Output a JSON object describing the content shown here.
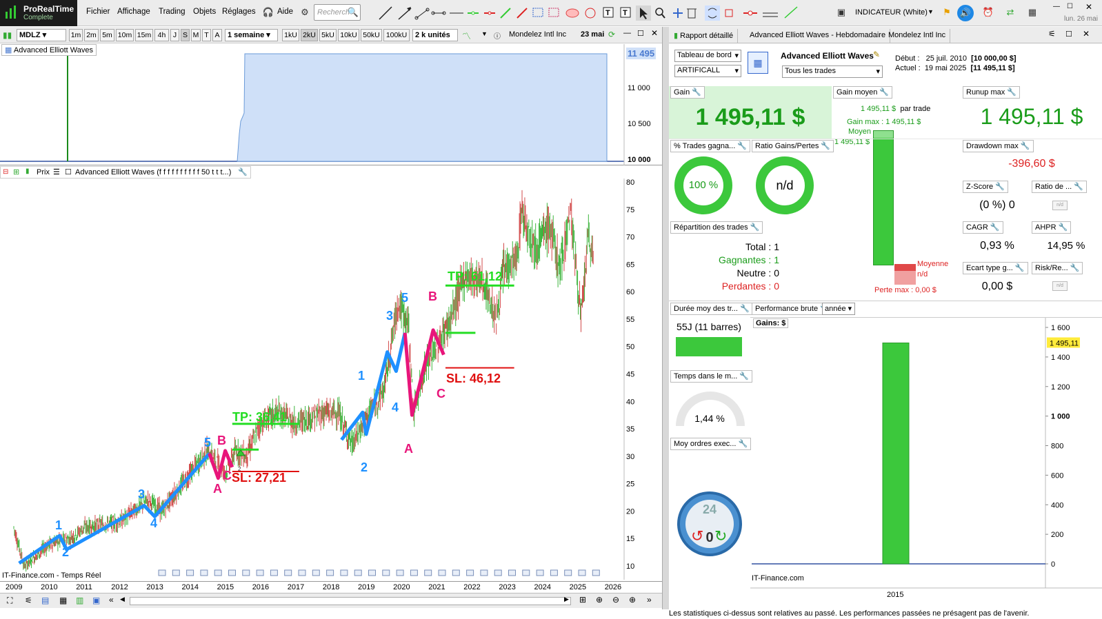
{
  "app": {
    "name": "ProRealTime",
    "edition": "Complete",
    "date": "lun. 26 mai"
  },
  "menu": [
    "Fichier",
    "Affichage",
    "Trading",
    "Objets",
    "Réglages",
    "Aide"
  ],
  "search": {
    "placeholder": "Recherch"
  },
  "indicator_mode": "INDICATEUR (White)",
  "chart_toolbar": {
    "symbol": "MDLZ",
    "timeframes": [
      "1m",
      "2m",
      "5m",
      "10m",
      "15m",
      "4h",
      "J",
      "S",
      "M",
      "T",
      "A"
    ],
    "active_tf": "S",
    "period": "1 semaine",
    "tick_buttons": [
      "1kU",
      "2kU",
      "5kU",
      "10kU",
      "50kU",
      "100kU"
    ],
    "active_tick": "2kU",
    "units": "2 k unités",
    "instrument": "Mondelez Intl Inc",
    "instrument_date": "23 mai"
  },
  "equity_panel": {
    "label": "Advanced Elliott Waves",
    "y_ticks": [
      "11 000",
      "10 500",
      "10 000"
    ],
    "current": "11 495"
  },
  "price_panel": {
    "label_prix": "Prix",
    "label_ind": "Advanced Elliott Waves (f f f f f f f f f f 50 t t t...)",
    "y_ticks": [
      "80",
      "75",
      "70",
      "65",
      "60",
      "55",
      "50",
      "45",
      "40",
      "35",
      "30",
      "25",
      "20",
      "15",
      "10"
    ],
    "watermark": "IT-Finance.com - Temps Réel",
    "x_ticks": [
      "2009",
      "2010",
      "2011",
      "2012",
      "2013",
      "2014",
      "2015",
      "2016",
      "2017",
      "2018",
      "2019",
      "2020",
      "2021",
      "2022",
      "2023",
      "2024",
      "2025",
      "2026"
    ],
    "waves": {
      "w1": "1",
      "w2": "2",
      "w3": "3",
      "w4": "4",
      "w5": "5",
      "wA": "A",
      "wB": "B",
      "wC": "C",
      "n1": "1",
      "n2": "2",
      "n3": "3",
      "n4": "4",
      "n5": "5",
      "nA": "A",
      "nB": "B",
      "nC": "C"
    },
    "tp1": "TP: 36,41",
    "sl1": "SL: 27,21",
    "tp2": "TP: 61,12",
    "sl2": "SL: 46,12",
    "small_mark": "2"
  },
  "right_tabs": [
    "Rapport détaillé",
    "Advanced Elliott Waves - Hebdomadaire",
    "Mondelez Intl Inc"
  ],
  "report": {
    "selects": {
      "dashboard": "Tableau de bord",
      "account": "ARTIFICALL",
      "trades": "Tous les trades"
    },
    "strategy": "Advanced Elliott Waves",
    "debut_lbl": "Début :",
    "debut_date": "25 juil. 2010",
    "debut_val": "[10 000,00 $]",
    "actuel_lbl": "Actuel :",
    "actuel_date": "19 mai 2025",
    "actuel_val": "[11 495,11 $]",
    "gain_lbl": "Gain",
    "gain_val": "1 495,11 $",
    "gain_moyen_lbl": "Gain moyen",
    "gain_moyen_val": "1 495,11 $",
    "par_trade": "par trade",
    "gain_max": "Gain max : 1 495,11 $",
    "moyen_lbl": "Moyen",
    "moyen_val": "1 495,11 $",
    "moyenne_lbl": "Moyenne",
    "moyenne_val": "n/d",
    "perte_max": "Perte max : 0,00 $",
    "runup_lbl": "Runup max",
    "runup_val": "1 495,11 $",
    "drawdown_lbl": "Drawdown max",
    "drawdown_val": "-396,60 $",
    "trades_gagnants_lbl": "% Trades gagna...",
    "trades_gagnants_val": "100 %",
    "ratio_lbl": "Ratio Gains/Pertes",
    "ratio_val": "n/d",
    "zscore_lbl": "Z-Score",
    "zscore_val": "(0 %) 0",
    "ratio2_lbl": "Ratio de ...",
    "nd_small": "n/d",
    "cagr_lbl": "CAGR",
    "cagr_val": "0,93 %",
    "ahpr_lbl": "AHPR",
    "ahpr_val": "14,95 %",
    "ecart_lbl": "Ecart type g...",
    "ecart_val": "0,00 $",
    "riskre_lbl": "Risk/Re...",
    "repartition_lbl": "Répartition des trades",
    "total_lbl": "Total :",
    "total_val": "1",
    "gagnantes_lbl": "Gagnantes :",
    "gagnantes_val": "1",
    "neutre_lbl": "Neutre :",
    "neutre_val": "0",
    "perdantes_lbl": "Perdantes :",
    "perdantes_val": "0",
    "duree_lbl": "Durée moy des tr...",
    "duree_val": "55J (11 barres)",
    "temps_lbl": "Temps dans le m...",
    "temps_val": "1,44 %",
    "moy_ordres_lbl": "Moy ordres exec...",
    "clock_top": "24",
    "clock_mid": "0",
    "perf_lbl": "Performance brute",
    "perf_period": "année",
    "gains_lbl": "Gains: $",
    "perf_watermark": "IT-Finance.com",
    "perf_y": [
      "1 600",
      "1 400",
      "1 200",
      "1 000",
      "800",
      "600",
      "400",
      "200",
      "0"
    ],
    "perf_current": "1 495,11",
    "footer": "Les statistiques ci-dessus sont relatives au passé. Les performances passées ne présagent pas de l'avenir."
  },
  "chart_data": {
    "type": "bar",
    "categories": [
      "2015"
    ],
    "values": [
      1495.11
    ],
    "title": "Performance brute",
    "ylabel": "Gains: $",
    "ylim": [
      0,
      1600
    ]
  },
  "colors": {
    "wave_blue": "#1e90ff",
    "wave_pink": "#e8157a",
    "tp_green": "#22dd22",
    "sl_red": "#e01010",
    "gain_green": "#3cc83c"
  }
}
